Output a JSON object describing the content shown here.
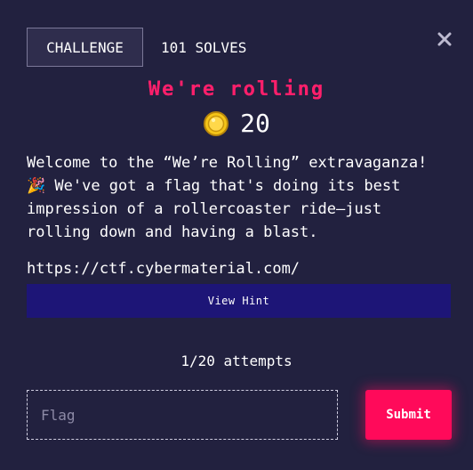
{
  "tabs": {
    "challenge_label": "CHALLENGE",
    "solves_label": "101 SOLVES"
  },
  "challenge": {
    "title": "We're rolling",
    "points": "20",
    "description": "Welcome to the “We’re Rolling” extravaganza! 🎉 We've got a flag that's doing its best impression of a rollercoaster ride—just rolling down and having a blast.",
    "link": "https://ctf.cybermaterial.com/"
  },
  "hint": {
    "button_label": "View Hint"
  },
  "attempts": {
    "text": "1/20 attempts"
  },
  "form": {
    "flag_placeholder": "Flag",
    "flag_value": "",
    "submit_label": "Submit"
  },
  "icons": {
    "close": "close-icon",
    "coin": "coin-icon"
  },
  "colors": {
    "background": "#22213f",
    "title_accent": "#ff1f6b",
    "hint_button": "#1d1577",
    "submit_button": "#ff0a5a",
    "coin_gold": "#f5c518"
  }
}
